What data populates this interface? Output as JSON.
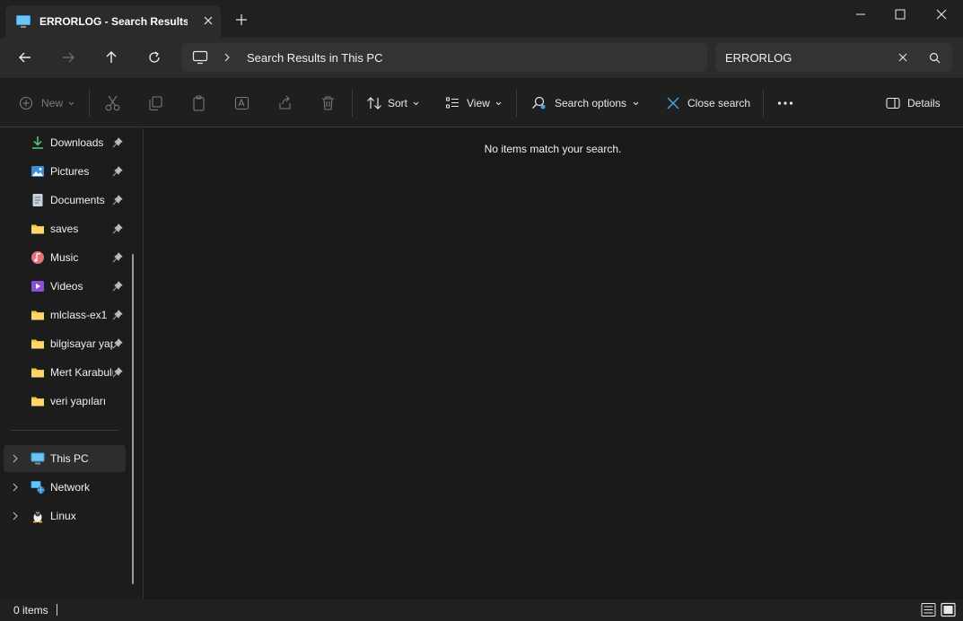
{
  "tab": {
    "title": "ERRORLOG - Search Results in"
  },
  "address": {
    "location": "Search Results in This PC"
  },
  "search": {
    "value": "ERRORLOG"
  },
  "toolbar": {
    "new_label": "New",
    "sort_label": "Sort",
    "view_label": "View",
    "search_options_label": "Search options",
    "close_search_label": "Close search",
    "details_label": "Details"
  },
  "sidebar": {
    "quick_access": [
      {
        "label": "Downloads",
        "icon": "download-icon",
        "pinned": true
      },
      {
        "label": "Pictures",
        "icon": "pictures-icon",
        "pinned": true
      },
      {
        "label": "Documents",
        "icon": "documents-icon",
        "pinned": true
      },
      {
        "label": "saves",
        "icon": "folder-icon",
        "pinned": true
      },
      {
        "label": "Music",
        "icon": "music-icon",
        "pinned": true
      },
      {
        "label": "Videos",
        "icon": "videos-icon",
        "pinned": true
      },
      {
        "label": "mlclass-ex1",
        "icon": "folder-icon",
        "pinned": true
      },
      {
        "label": "bilgisayar yapısı",
        "icon": "folder-icon",
        "pinned": true
      },
      {
        "label": "Mert Karabulut",
        "icon": "folder-icon",
        "pinned": true
      },
      {
        "label": "veri yapıları",
        "icon": "folder-icon",
        "pinned": false
      }
    ],
    "locations": [
      {
        "label": "This PC",
        "icon": "computer-icon",
        "selected": true
      },
      {
        "label": "Network",
        "icon": "network-icon",
        "selected": false
      },
      {
        "label": "Linux",
        "icon": "linux-icon",
        "selected": false
      }
    ]
  },
  "content": {
    "empty_message": "No items match your search."
  },
  "status": {
    "items_count": "0 items"
  },
  "colors": {
    "folder": "#f4c144",
    "accent": "#4aa3df",
    "background": "#1c1c1c"
  }
}
